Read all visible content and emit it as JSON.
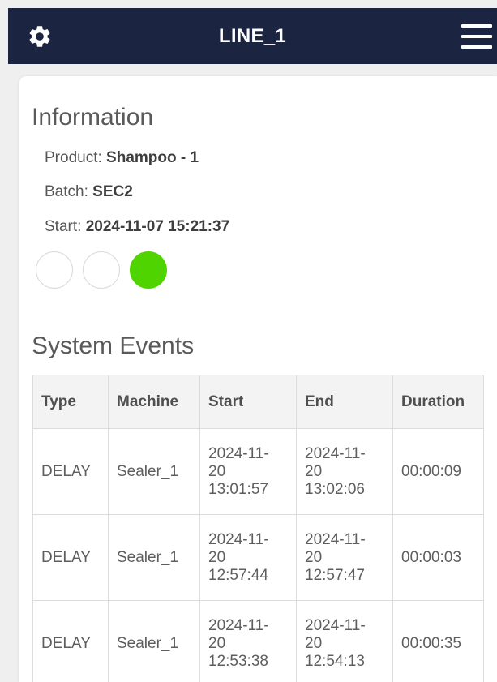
{
  "header": {
    "title": "LINE_1",
    "settings_icon": "gear-icon",
    "menu_icon": "hamburger-menu-icon",
    "background_color": "#1b2440"
  },
  "information": {
    "heading": "Information",
    "product_label": "Product:",
    "product_value": "Shampoo - 1",
    "batch_label": "Batch:",
    "batch_value": "SEC2",
    "start_label": "Start:",
    "start_value": "2024-11-07 15:21:37",
    "status_lights": [
      {
        "state": "off",
        "color": "#ffffff"
      },
      {
        "state": "off",
        "color": "#ffffff"
      },
      {
        "state": "on",
        "color": "#4fd400"
      }
    ]
  },
  "events": {
    "heading": "System Events",
    "columns": [
      "Type",
      "Machine",
      "Start",
      "End",
      "Duration"
    ],
    "rows": [
      {
        "type": "DELAY",
        "machine": "Sealer_1",
        "start": [
          "2024-11-",
          "20",
          "13:01:57"
        ],
        "end": [
          "2024-11-",
          "20",
          "13:02:06"
        ],
        "duration": "00:00:09"
      },
      {
        "type": "DELAY",
        "machine": "Sealer_1",
        "start": [
          "2024-11-",
          "20",
          "12:57:44"
        ],
        "end": [
          "2024-11-",
          "20",
          "12:57:47"
        ],
        "duration": "00:00:03"
      },
      {
        "type": "DELAY",
        "machine": "Sealer_1",
        "start": [
          "2024-11-",
          "20",
          "12:53:38"
        ],
        "end": [
          "2024-11-",
          "20",
          "12:54:13"
        ],
        "duration": "00:00:35"
      }
    ]
  }
}
